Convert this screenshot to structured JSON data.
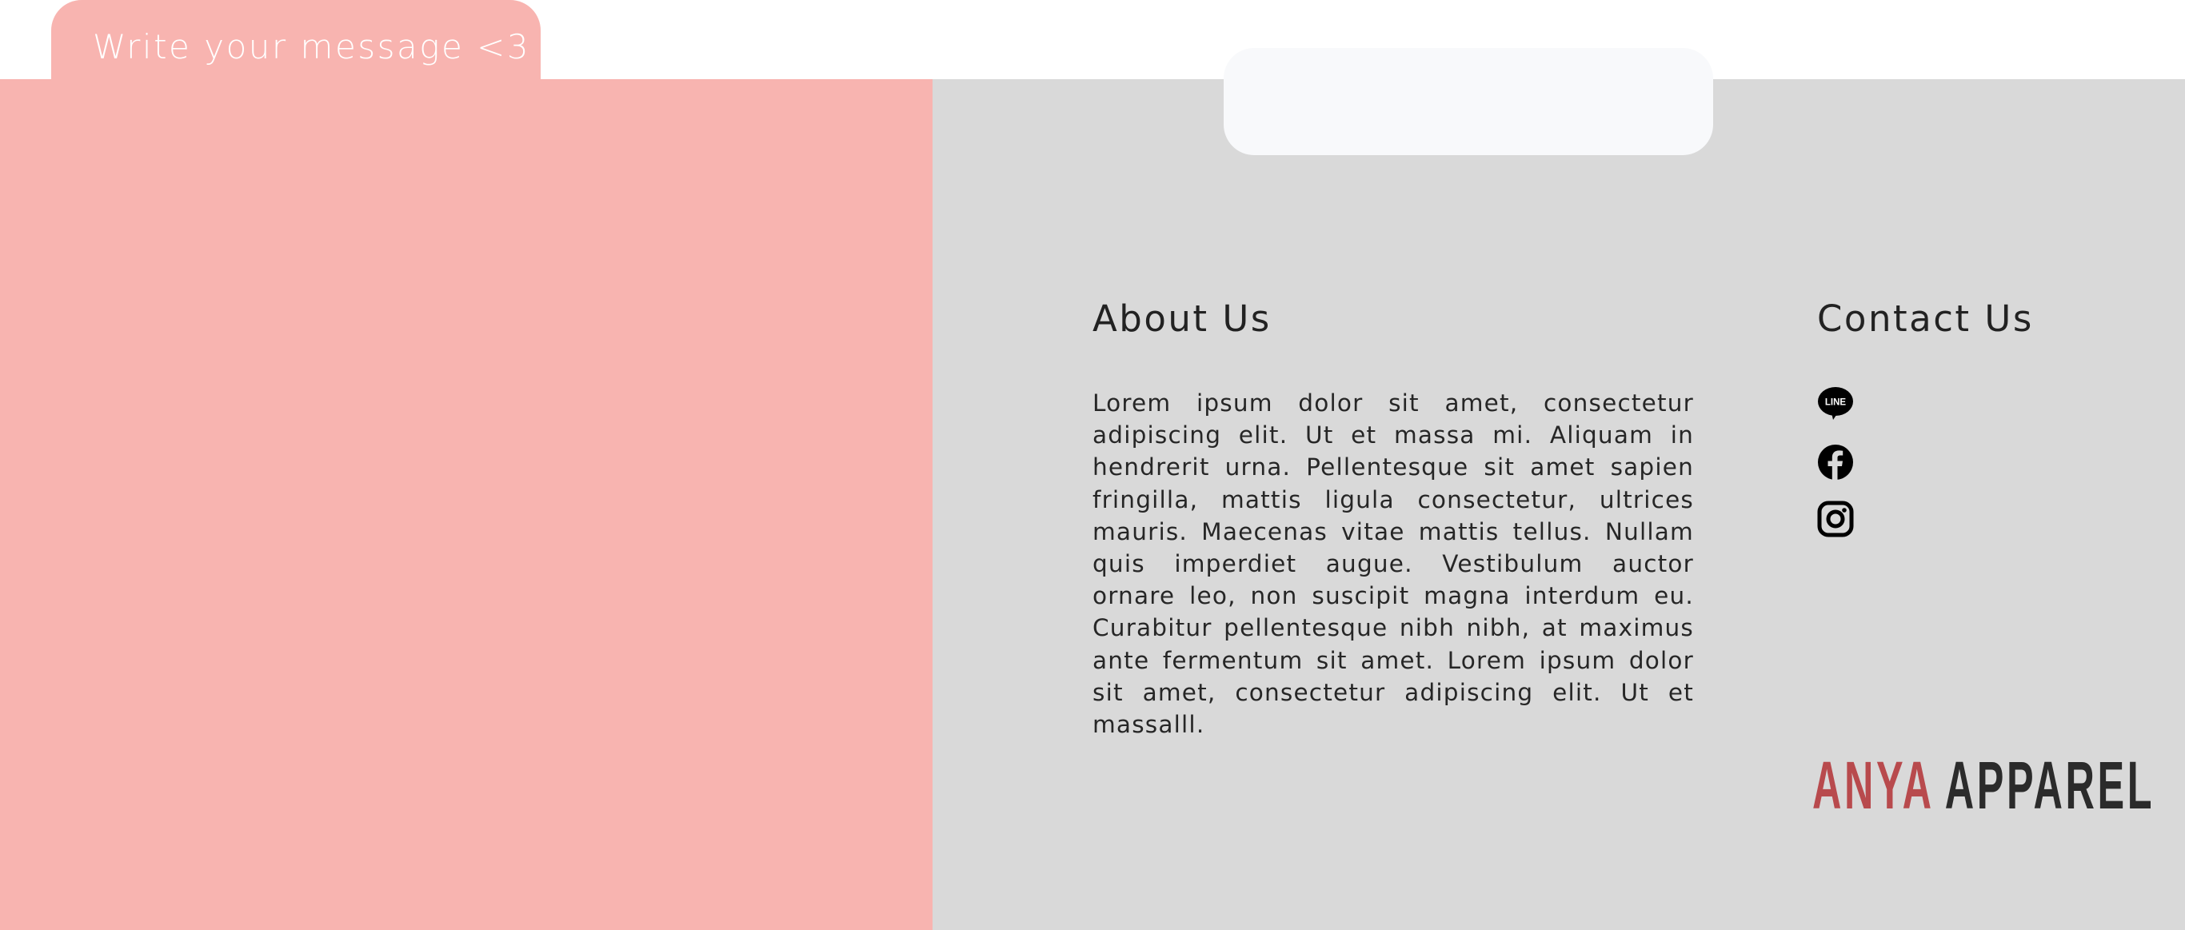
{
  "message_tab": {
    "label": "Write your message <3"
  },
  "about": {
    "title": "About Us",
    "body": "Lorem ipsum dolor sit amet, consectetur adipiscing elit. Ut et massa mi. Aliquam in hendrerit urna. Pellentesque sit amet sapien fringilla, mattis ligula consectetur, ultrices mauris. Maecenas vitae mattis tellus. Nullam quis imperdiet augue. Vestibulum auctor ornare leo, non suscipit magna interdum eu. Curabitur pellentesque nibh nibh, at maximus ante fermentum sit amet. Lorem ipsum dolor sit amet, consectetur adipiscing elit. Ut et massalll."
  },
  "contact": {
    "title": "Contact Us",
    "icons": [
      "line-icon",
      "facebook-icon",
      "instagram-icon"
    ],
    "line_icon_text": "LINE"
  },
  "brand": {
    "first": "ANYA",
    "second": "APPAREL"
  },
  "colors": {
    "message_panel": "#f8b4b0",
    "info_panel": "#d9d9d9",
    "floating_box": "#f8f9fb",
    "brand_accent": "#b84a4d",
    "brand_dark": "#2b2b2b",
    "text_dark": "#222222"
  }
}
